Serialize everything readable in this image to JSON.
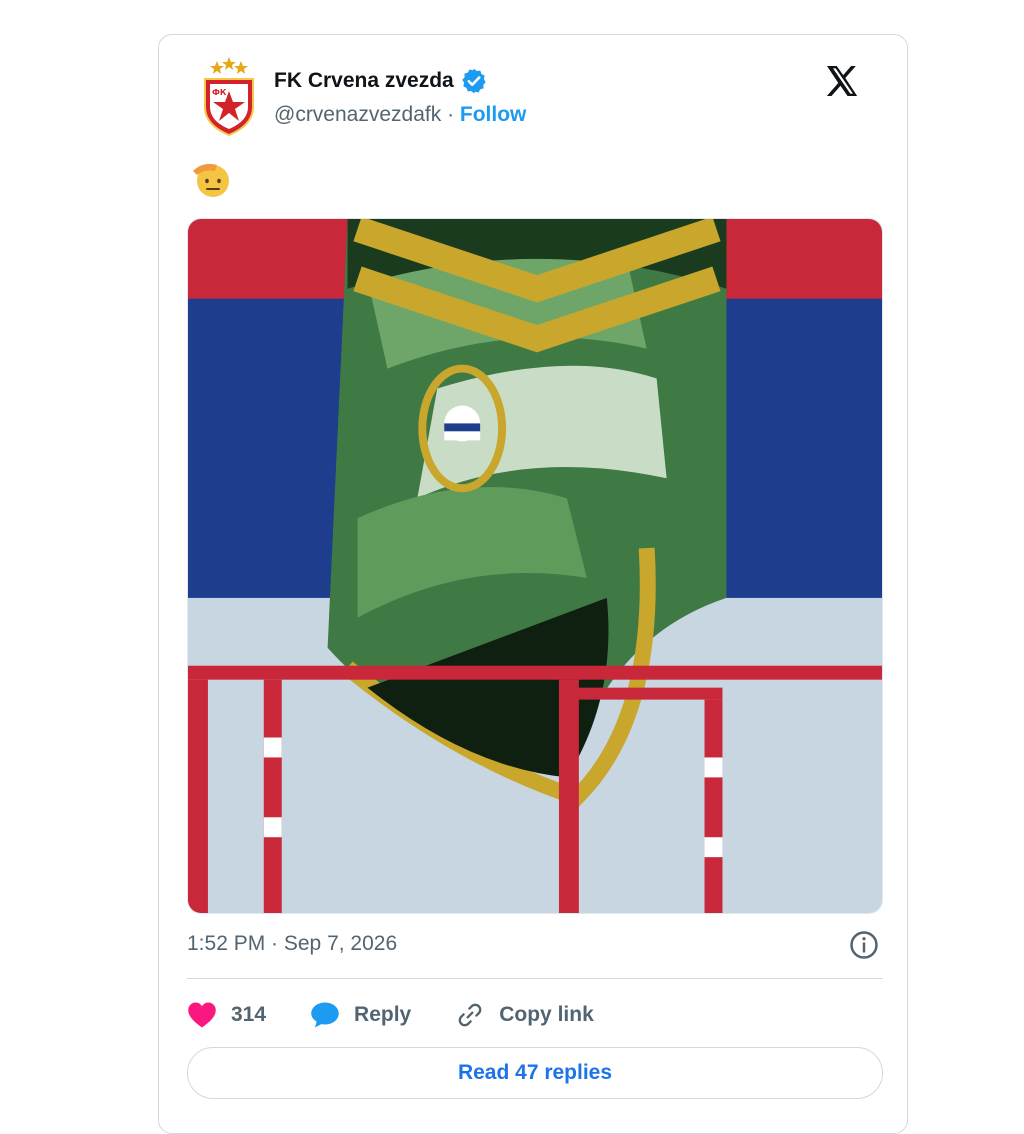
{
  "tweet": {
    "author_name": "FK Crvena zvezda",
    "handle": "@crvenazvezdafk",
    "separator": " · ",
    "follow_label": "Follow",
    "timestamp": "1:52 PM · Sep 7, 2026"
  },
  "actions": {
    "likes_count": "314",
    "reply_label": "Reply",
    "copy_link_label": "Copy link"
  },
  "read_replies_label": "Read 47 replies",
  "icons": {
    "verified": "verified-badge-icon",
    "platform": "x-logo-icon",
    "like": "heart-icon",
    "reply": "reply-bubble-icon",
    "copy": "link-icon",
    "info": "info-icon",
    "emoji": "saluting-face-emoji"
  },
  "colors": {
    "brand_blue": "#1d9bf0",
    "like_pink": "#f91880",
    "text_secondary": "#536471",
    "border": "#cfd9de"
  }
}
